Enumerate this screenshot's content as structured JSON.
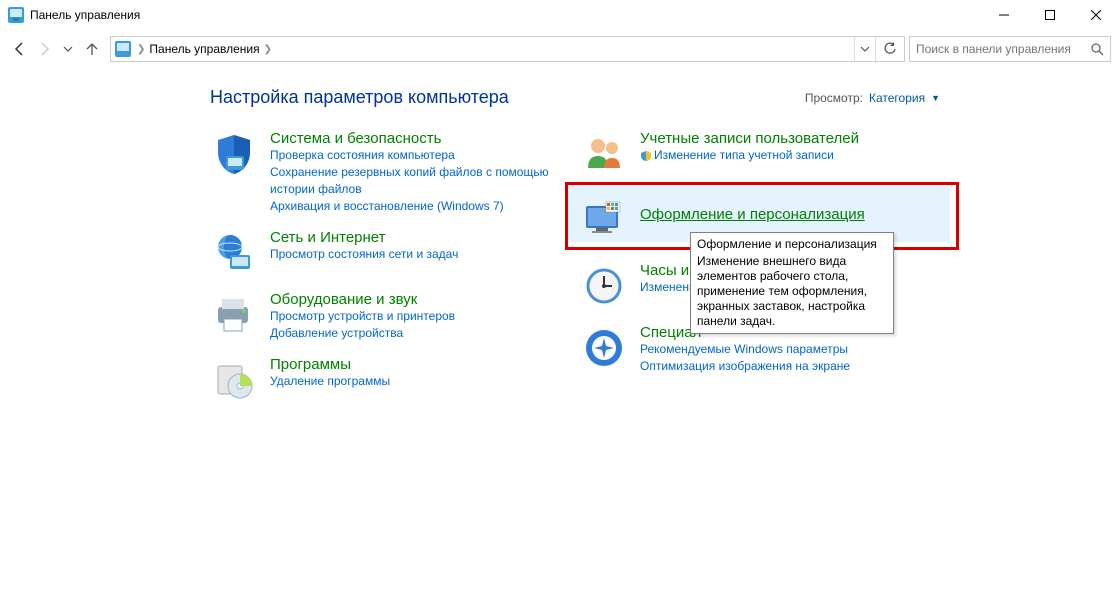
{
  "window": {
    "title": "Панель управления"
  },
  "address": {
    "crumb": "Панель управления"
  },
  "search": {
    "placeholder": "Поиск в панели управления"
  },
  "heading": "Настройка параметров компьютера",
  "viewmode": {
    "label": "Просмотр:",
    "value": "Категория"
  },
  "left": {
    "system": {
      "title": "Система и безопасность",
      "links": [
        "Проверка состояния компьютера",
        "Сохранение резервных копий файлов с помощью истории файлов",
        "Архивация и восстановление (Windows 7)"
      ]
    },
    "network": {
      "title": "Сеть и Интернет",
      "links": [
        "Просмотр состояния сети и задач"
      ]
    },
    "hardware": {
      "title": "Оборудование и звук",
      "links": [
        "Просмотр устройств и принтеров",
        "Добавление устройства"
      ]
    },
    "programs": {
      "title": "Программы",
      "links": [
        "Удаление программы"
      ]
    }
  },
  "right": {
    "users": {
      "title": "Учетные записи пользователей",
      "links": [
        "Изменение типа учетной записи"
      ]
    },
    "personalization": {
      "title": "Оформление и персонализация"
    },
    "clock": {
      "title": "Часы и регион",
      "links": [
        "Изменение форматов даты, времени и чисел"
      ],
      "visible_link_prefix": "Изменение "
    },
    "ease": {
      "title": "Специальные возможности",
      "visible_title_prefix": "Специал",
      "links": [
        "Рекомендуемые Windows параметры",
        "Оптимизация изображения на экране"
      ]
    }
  },
  "tooltip": {
    "title": "Оформление и персонализация",
    "body": "Изменение внешнего вида элементов рабочего стола, применение тем оформления, экранных заставок, настройка панели задач."
  }
}
